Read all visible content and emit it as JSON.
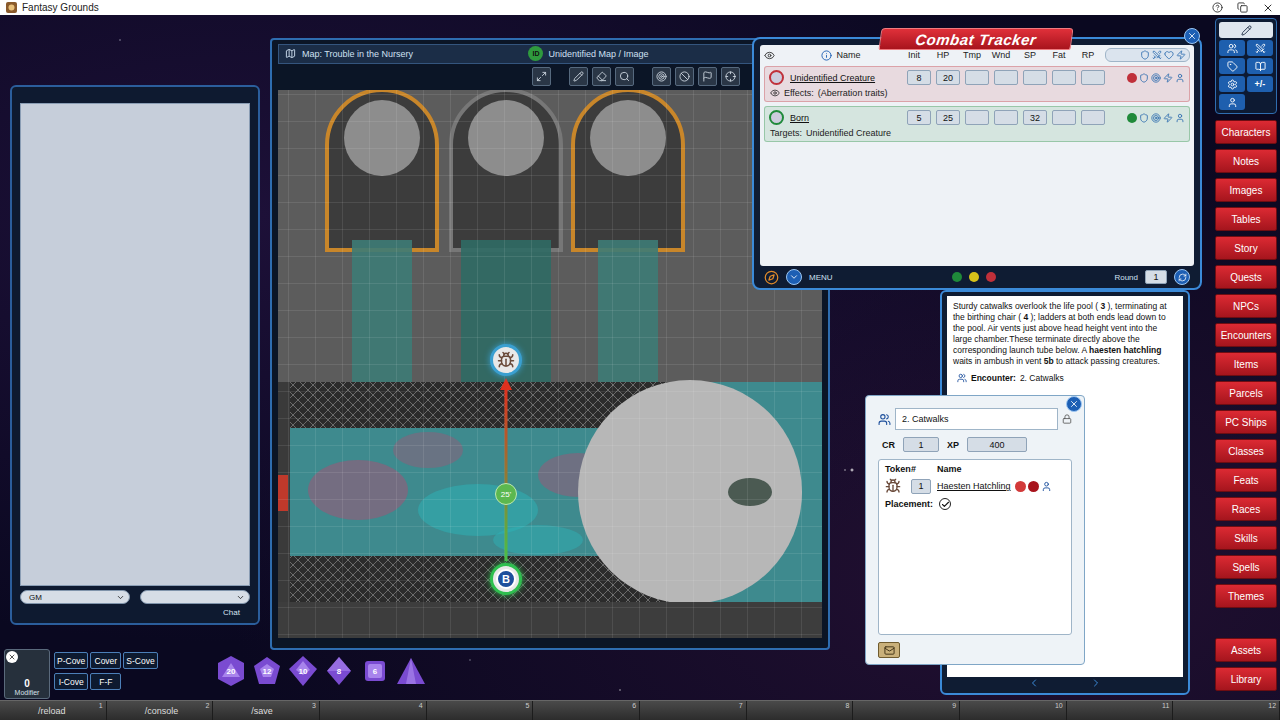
{
  "window": {
    "title": "Fantasy Grounds"
  },
  "chat": {
    "identity": "GM",
    "target": "",
    "send": "Chat"
  },
  "map": {
    "title": "Map: Trouble in the Nursery",
    "id_badge": "ID",
    "status": "Unidentified Map / Image",
    "measure": "25'",
    "tokens": [
      {
        "label": "",
        "color": "#3a9fd0"
      },
      {
        "label": "B",
        "color": "#2fbf4f"
      }
    ]
  },
  "tracker": {
    "title": "Combat Tracker",
    "columns": [
      "Name",
      "Init",
      "HP",
      "Tmp",
      "Wnd",
      "SP",
      "Fat",
      "RP"
    ],
    "rows": [
      {
        "name": "Unidentified Creature",
        "values": [
          "8",
          "20",
          "",
          "",
          "",
          "",
          ""
        ],
        "detail_label": "Effects:",
        "detail": "(Aberration traits)",
        "color": "#c0303a"
      },
      {
        "name": "Born",
        "values": [
          "5",
          "25",
          "",
          "",
          "32",
          "",
          ""
        ],
        "detail_label": "Targets:",
        "detail": "Unidentified Creature",
        "color": "#1f8a3a"
      }
    ],
    "menu": "MENU",
    "factions": [
      "#1f8a3a",
      "#d8c21a",
      "#c0303a"
    ],
    "round_label": "Round",
    "round": "1"
  },
  "story": {
    "segments": [
      {
        "text": "Sturdy catwalks overlook the life pool ( ",
        "bold": false
      },
      {
        "text": "3",
        "bold": true
      },
      {
        "text": " ), terminating at the birthing chair ( ",
        "bold": false
      },
      {
        "text": "4",
        "bold": true
      },
      {
        "text": " ); ladders at both ends lead down to the pool. Air vents just above head height vent into the large chamber.These terminate directly above the corresponding launch tube below. A ",
        "bold": false
      },
      {
        "text": "haesten hatchling",
        "bold": true
      },
      {
        "text": " waits in ambush in vent ",
        "bold": false
      },
      {
        "text": "5b",
        "bold": true
      },
      {
        "text": " to attack passing creatures.",
        "bold": false
      }
    ],
    "encounter_label": "Encounter:",
    "encounter": "2. Catwalks"
  },
  "encounter": {
    "title": "2. Catwalks",
    "cr_label": "CR",
    "cr": "1",
    "xp_label": "XP",
    "xp": "400",
    "columns": [
      "Token",
      "#",
      "Name"
    ],
    "rows": [
      {
        "count": "1",
        "name": "Haesten Hatchling"
      }
    ],
    "placement_label": "Placement:",
    "placement": true
  },
  "sidebar": {
    "tool_label": "+/-",
    "buttons": [
      "Characters",
      "Notes",
      "Images",
      "Tables",
      "Story",
      "Quests",
      "NPCs",
      "Encounters",
      "Items",
      "Parcels",
      "PC Ships",
      "Classes",
      "Feats",
      "Races",
      "Skills",
      "Spells",
      "Themes"
    ],
    "bottom_buttons": [
      "Assets",
      "Library"
    ]
  },
  "modifier": {
    "value": "0",
    "label": "Modifier"
  },
  "cover": [
    "P-Cove",
    "Cover",
    "S-Cove",
    "I-Cove",
    "F-F"
  ],
  "dice": [
    {
      "kind": "d20",
      "label": "20"
    },
    {
      "kind": "d12",
      "label": "12"
    },
    {
      "kind": "d10",
      "label": "10"
    },
    {
      "kind": "d8",
      "label": "8"
    },
    {
      "kind": "d6",
      "label": "6"
    },
    {
      "kind": "d4",
      "label": ""
    }
  ],
  "hotkeys": [
    {
      "number": "1",
      "command": "/reload"
    },
    {
      "number": "2",
      "command": "/console"
    },
    {
      "number": "3",
      "command": "/save"
    },
    {
      "number": "4",
      "command": ""
    },
    {
      "number": "5",
      "command": ""
    },
    {
      "number": "6",
      "command": ""
    },
    {
      "number": "7",
      "command": ""
    },
    {
      "number": "8",
      "command": ""
    },
    {
      "number": "9",
      "command": ""
    },
    {
      "number": "10",
      "command": ""
    },
    {
      "number": "11",
      "command": ""
    },
    {
      "number": "12",
      "command": ""
    }
  ]
}
